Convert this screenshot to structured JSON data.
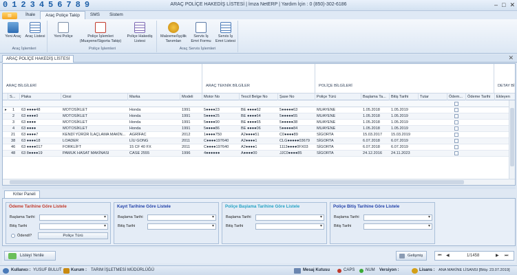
{
  "window": {
    "digits": [
      "0",
      "1",
      "2",
      "3",
      "4",
      "5",
      "6",
      "7",
      "8",
      "9"
    ],
    "title": "ARAÇ POLİÇE HAKEDİŞ LİSTESİ  | İmza NetERP  | Yardım İçin :  0 (850)-302-6186",
    "controls": [
      "‒",
      "□",
      "✕"
    ]
  },
  "ribbon": {
    "tabs": [
      "İhale",
      "Araç Poliçe Takip",
      "SMS",
      "Sistem"
    ],
    "groups": [
      {
        "title": "Araç İşlemleri",
        "buttons": [
          "Yeni Araç",
          "Araç Listesi"
        ]
      },
      {
        "title": "Poliçe İşlemleri",
        "buttons": [
          "Yeni Poliçe",
          "Poliçe İşlemleri (Muayene/Sigorta Takip)",
          "Poliçe Hakediş Listesi"
        ]
      },
      {
        "title": "Araç Servis İşlemleri",
        "buttons": [
          "Malzeme/İşçilik Tanımları",
          "Servis İş Emri Formu",
          "Servis İş Emri Listesi"
        ]
      }
    ]
  },
  "doc_tab": {
    "label": "ARAÇ POLİÇE HAKEDİŞ LİSTESİ",
    "close": "✕"
  },
  "grid": {
    "bands": [
      "ARAÇ BİLGİLERİ",
      "ARAÇ TEKNİK BİLGİLER",
      "POLİÇE BİLGİLERİ",
      "DETAY Bİ"
    ],
    "columns": [
      "S...",
      "Plaka",
      "Cinsi",
      "Marka",
      "Modeli",
      "Motor No",
      "Tescil Belge No",
      "Şase No",
      "Poliçe Türü",
      "Başlama Ta...",
      "Bitiş Tarihi",
      "Tutar",
      "Ödem...",
      "Ödeme Tarihi",
      "Ekleyen"
    ],
    "rows": [
      {
        "s": "1",
        "plaka": "63 ●●●●48",
        "cinsi": "MOTOSİKLET",
        "marka": "Honda",
        "model": "1991",
        "motor": "5●●●●23",
        "tescil": "BE ●●●●62",
        "sase": "5●●●●●63",
        "tur": "MUAYENE",
        "bas": "1.05.2018",
        "bit": "1.05.2019"
      },
      {
        "s": "2",
        "plaka": "63 ●●●●9",
        "cinsi": "MOTOSİKLET",
        "marka": "Honda",
        "model": "1991",
        "motor": "5●●●●25",
        "tescil": "BE ●●●●64",
        "sase": "5●●●●●55",
        "tur": "MUAYENE",
        "bas": "1.05.2018",
        "bit": "1.05.2019"
      },
      {
        "s": "3",
        "plaka": "63 ●●●●",
        "cinsi": "MOTOSİKLET",
        "marka": "Honda",
        "model": "1991",
        "motor": "5●●●●90",
        "tescil": "BE ●●●●65",
        "sase": "5●●●●●38",
        "tur": "MUAYENE",
        "bas": "1.05.2018",
        "bit": "1.05.2019"
      },
      {
        "s": "4",
        "plaka": "63 ●●●●",
        "cinsi": "MOTOSİKLET",
        "marka": "Honda",
        "model": "1991",
        "motor": "5●●●●86",
        "tescil": "BE ●●●●06",
        "sase": "5●●●●●84",
        "tur": "MUAYENE",
        "bas": "1.05.2018",
        "bit": "1.05.2019"
      },
      {
        "s": "21",
        "plaka": "63 ●●●●7",
        "cinsi": "KENDİ YÜRÜR İLAÇLAMA MAKİN...",
        "marka": "AGRİFAC",
        "model": "2012",
        "motor": "1●●●●750",
        "tescil": "A2●●●●51",
        "sase": "C0●●●●89",
        "tur": "SİGORTA",
        "bas": "15.03.2017",
        "bit": "15.03.2019"
      },
      {
        "s": "38",
        "plaka": "63 ●●●●18",
        "cinsi": "LOADER",
        "marka": "LİU GONG",
        "model": "2011",
        "motor": "C●●●●197640",
        "tescil": "A2●●●●1",
        "sase": "CLG●●●●●03679",
        "tur": "SİGORTA",
        "bas": "6.07.2018",
        "bit": "6.07.2019"
      },
      {
        "s": "46",
        "plaka": "63 ●●●●017",
        "cinsi": "FORKLİFT",
        "marka": "15 CF 40 FX",
        "model": "2011",
        "motor": "C●●●●197640",
        "tescil": "A2●●●●1",
        "sase": "1113●●●●0FX03",
        "tur": "SİGORTA",
        "bas": "6.07.2018",
        "bit": "6.07.2019"
      },
      {
        "s": "48",
        "plaka": "63 8●●●●19",
        "cinsi": "PAMUK HASAT MAKİNASI",
        "marka": "CASE 2555",
        "model": "1996",
        "motor": "4●●●●●●",
        "tescil": "A●●●●00",
        "sase": "JJC0●●●●85",
        "tur": "SİGORTA",
        "bas": "24.12.2016",
        "bit": "24.11.2023"
      }
    ]
  },
  "criteria": {
    "tab_label": "Kriter Paneli",
    "boxes": [
      {
        "title": "Ödeme Tarihine Göre Listele",
        "title_color": "#c0392b",
        "start_label": "Başlama Tarihi",
        "end_label": "Bitiş Tarihi",
        "paid_label": "Ödendi?",
        "policy_type_btn": "Poliçe Türü"
      },
      {
        "title": "Kayıt Tarihine Göre Listele",
        "title_color": "#1f3fa8",
        "start_label": "Başlama Tarihi",
        "end_label": "Bitiş Tarihi"
      },
      {
        "title": "Poliçe Başlama Tarihine Göre Listele",
        "title_color": "#24a2c4",
        "start_label": "Başlama Tarihi",
        "end_label": "Bitiş Tarihi"
      },
      {
        "title": "Poliçe Bitiş Tarihine Göre Listele",
        "title_color": "#1f3fa8",
        "start_label": "Başlama Tarihi",
        "end_label": "Bitiş Tarihi"
      }
    ]
  },
  "bottom": {
    "refresh_label": "Listeyi Yenile",
    "advanced_label": "Gelişmiş",
    "pager_text": "1/1458"
  },
  "status": {
    "user_label": "Kullanıcı :",
    "user_value": "YUSUF BULUT",
    "unit_label": "Kurum :",
    "unit_value": "TARIM İŞLETMESİ MÜDÜRLÜĞÜ",
    "mail": "Mesaj Kutusu",
    "caps": "CAPS",
    "num": "NUM",
    "version": "Versiyon :",
    "license_label": "Lisans :",
    "license_value": "ANA MAKİNE LİSANSI [Bitiş: 23.07.2019]"
  }
}
